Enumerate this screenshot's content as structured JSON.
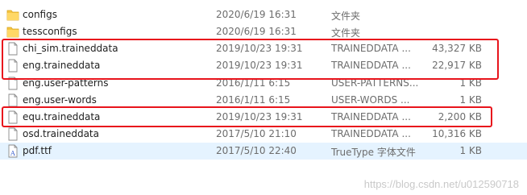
{
  "files": [
    {
      "name": "configs",
      "date": "2020/6/19 16:31",
      "type": "文件夹",
      "size": "",
      "icon": "folder-icon"
    },
    {
      "name": "tessconfigs",
      "date": "2020/6/19 16:31",
      "type": "文件夹",
      "size": "",
      "icon": "folder-icon"
    },
    {
      "name": "chi_sim.traineddata",
      "date": "2019/10/23 19:31",
      "type": "TRAINEDDATA ...",
      "size": "43,327 KB",
      "icon": "file-icon"
    },
    {
      "name": "eng.traineddata",
      "date": "2019/10/23 19:31",
      "type": "TRAINEDDATA ...",
      "size": "22,917 KB",
      "icon": "file-icon"
    },
    {
      "name": "eng.user-patterns",
      "date": "2016/1/11 6:15",
      "type": "USER-PATTERNS...",
      "size": "1 KB",
      "icon": "file-icon"
    },
    {
      "name": "eng.user-words",
      "date": "2016/1/11 6:15",
      "type": "USER-WORDS ...",
      "size": "1 KB",
      "icon": "file-icon"
    },
    {
      "name": "equ.traineddata",
      "date": "2019/10/23 19:31",
      "type": "TRAINEDDATA ...",
      "size": "2,200 KB",
      "icon": "file-icon"
    },
    {
      "name": "osd.traineddata",
      "date": "2017/5/10 21:10",
      "type": "TRAINEDDATA ...",
      "size": "10,316 KB",
      "icon": "file-icon"
    },
    {
      "name": "pdf.ttf",
      "date": "2017/5/10 22:40",
      "type": "TrueType 字体文件",
      "size": "1 KB",
      "icon": "font-file-icon"
    }
  ],
  "watermark": "https://blog.csdn.net/u012590718",
  "colors": {
    "highlight": "#e8141c",
    "folder": "#f5c542",
    "selected": "#e5f3ff"
  }
}
